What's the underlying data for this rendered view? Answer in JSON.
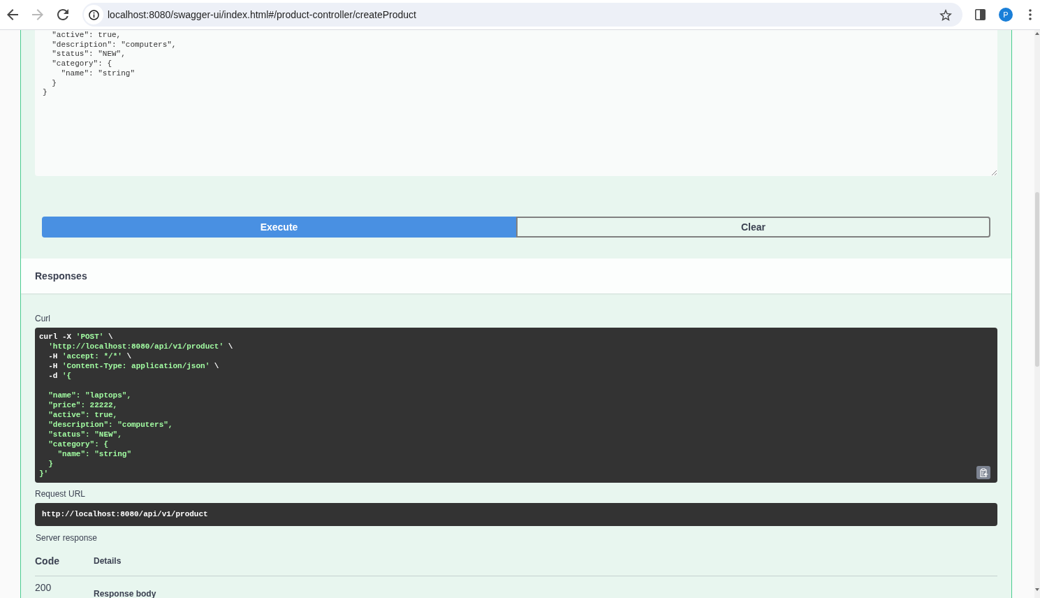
{
  "browser": {
    "nav_buttons": [
      {
        "kind": "back",
        "disabled": false
      },
      {
        "kind": "forward",
        "disabled": true
      },
      {
        "kind": "reload",
        "disabled": false
      }
    ],
    "url": "localhost:8080/swagger-ui/index.html#/product-controller/createProduct",
    "profile_initial": "P"
  },
  "request_body": {
    "value": "  \"active\": true,\n  \"description\": \"computers\",\n  \"status\": \"NEW\",\n  \"category\": {\n    \"name\": \"string\"\n  }\n}"
  },
  "actions": [
    {
      "label": "Execute",
      "kind": "primary"
    },
    {
      "label": "Clear",
      "kind": "secondary"
    }
  ],
  "responses": {
    "title": "Responses",
    "curl": {
      "label": "Curl",
      "tokens": [
        {
          "kind": "command",
          "text": "curl -X "
        },
        {
          "kind": "string",
          "text": "'POST'"
        },
        {
          "kind": "command",
          "text": " \\\n  "
        },
        {
          "kind": "string",
          "text": "'http://localhost:8080/api/v1/product'"
        },
        {
          "kind": "command",
          "text": " \\\n  -H "
        },
        {
          "kind": "string",
          "text": "'accept: */*'"
        },
        {
          "kind": "command",
          "text": " \\\n  -H "
        },
        {
          "kind": "string",
          "text": "'Content-Type: application/json'"
        },
        {
          "kind": "command",
          "text": " \\\n  -d "
        },
        {
          "kind": "string",
          "text": "'{\n\n  \"name\": \"laptops\",\n  \"price\": 22222,\n  \"active\": true,\n  \"description\": \"computers\",\n  \"status\": \"NEW\",\n  \"category\": {\n    \"name\": \"string\"\n  }\n}'"
        }
      ]
    },
    "request_url": {
      "label": "Request URL",
      "value": "http://localhost:8080/api/v1/product"
    },
    "server_response": {
      "label": "Server response",
      "columns": [
        "Code",
        "Details"
      ],
      "rows": [
        {
          "code": "200",
          "details_heading": "Response body"
        }
      ]
    }
  }
}
